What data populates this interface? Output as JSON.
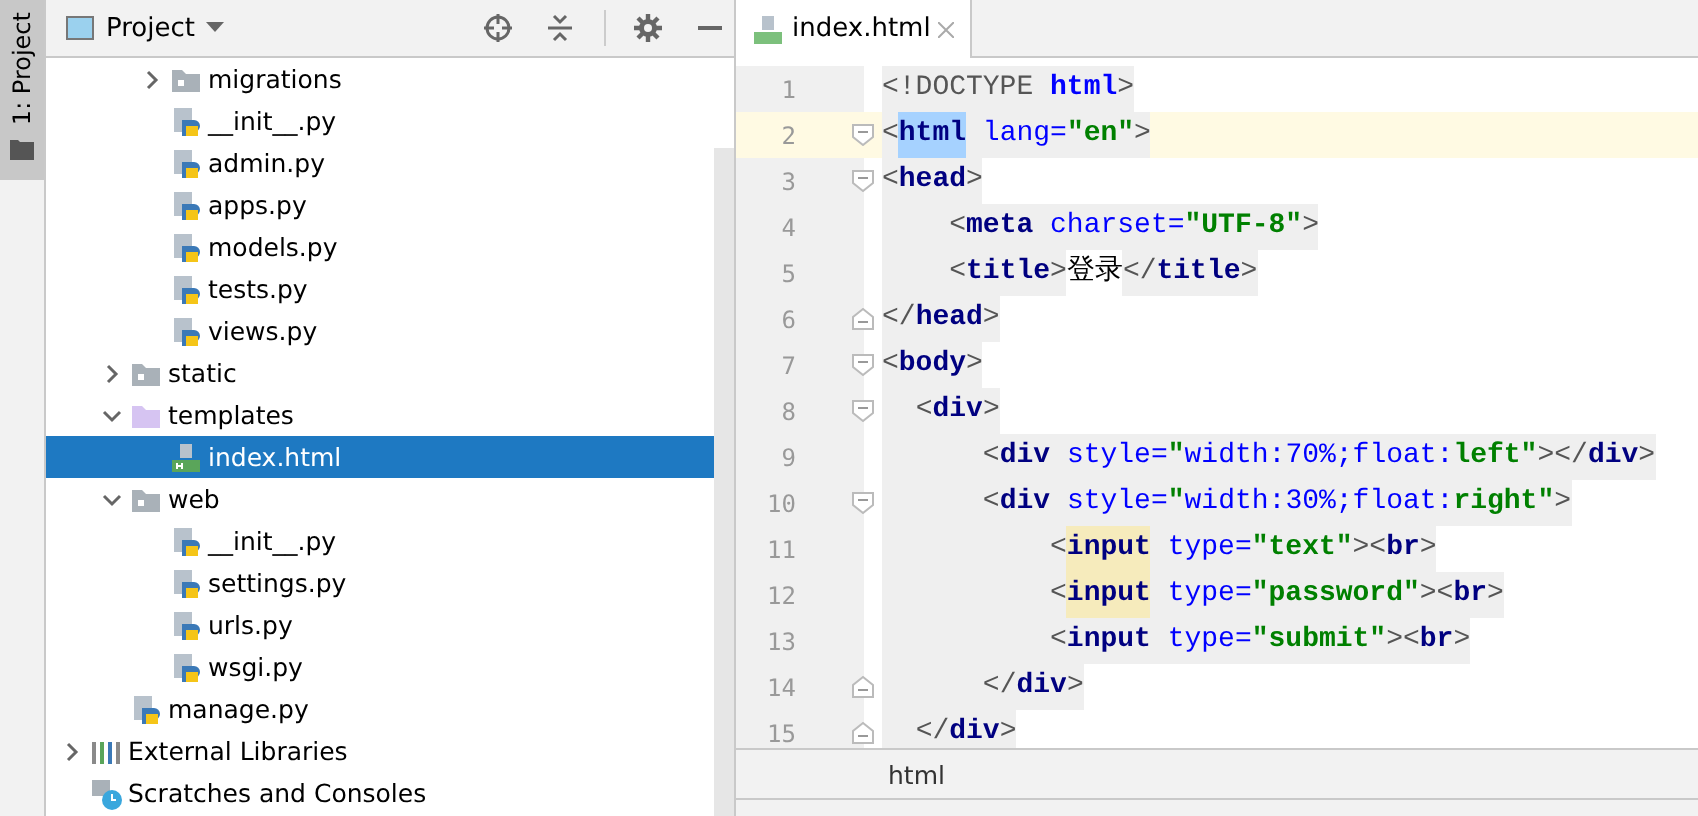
{
  "side_strip": {
    "label": "1: Project"
  },
  "project_panel": {
    "title": "Project",
    "tree": [
      {
        "kind": "hidden",
        "children": [
          {
            "kind": "hidden",
            "children": [
              {
                "label": "migrations",
                "kind": "folder",
                "expanded": false,
                "selected": false
              },
              {
                "label": "__init__.py",
                "kind": "python",
                "selected": false
              },
              {
                "label": "admin.py",
                "kind": "python",
                "selected": false
              },
              {
                "label": "apps.py",
                "kind": "python",
                "selected": false
              },
              {
                "label": "models.py",
                "kind": "python",
                "selected": false
              },
              {
                "label": "tests.py",
                "kind": "python",
                "selected": false
              },
              {
                "label": "views.py",
                "kind": "python",
                "selected": false
              }
            ]
          },
          {
            "label": "static",
            "kind": "folder",
            "expanded": false,
            "selected": false
          },
          {
            "label": "templates",
            "kind": "template-folder",
            "expanded": true,
            "selected": false,
            "children": [
              {
                "label": "index.html",
                "kind": "html",
                "selected": true
              }
            ]
          },
          {
            "label": "web",
            "kind": "folder",
            "expanded": true,
            "selected": false,
            "children": [
              {
                "label": "__init__.py",
                "kind": "python",
                "selected": false
              },
              {
                "label": "settings.py",
                "kind": "python",
                "selected": false
              },
              {
                "label": "urls.py",
                "kind": "python",
                "selected": false
              },
              {
                "label": "wsgi.py",
                "kind": "python",
                "selected": false
              }
            ]
          },
          {
            "label": "manage.py",
            "kind": "python",
            "selected": false
          }
        ]
      },
      {
        "label": "External Libraries",
        "kind": "library",
        "expanded": false,
        "selected": false
      },
      {
        "label": "Scratches and Consoles",
        "kind": "scratches",
        "selected": false
      }
    ]
  },
  "editor": {
    "tabs": [
      {
        "label": "index.html",
        "selected": true
      }
    ],
    "lines": [
      {
        "number": "1",
        "current": false,
        "fold_start": false,
        "fold_end": false,
        "tokens": [
          {
            "kind": "punct",
            "text": "<!DOCTYPE "
          },
          {
            "kind": "keyword",
            "text": "html"
          },
          {
            "kind": "punct",
            "text": ">"
          }
        ]
      },
      {
        "number": "2",
        "current": true,
        "fold_start": true,
        "fold_end": false,
        "tokens": [
          {
            "kind": "punct",
            "text": "<"
          },
          {
            "kind": "tag-match",
            "text": "html"
          },
          {
            "kind": "attr",
            "text": " lang="
          },
          {
            "kind": "value",
            "text": "\"en\""
          },
          {
            "kind": "punct",
            "text": ">"
          }
        ]
      },
      {
        "number": "3",
        "current": false,
        "fold_start": true,
        "fold_end": false,
        "tokens": [
          {
            "kind": "punct",
            "text": "<"
          },
          {
            "kind": "tag",
            "text": "head"
          },
          {
            "kind": "punct",
            "text": ">"
          }
        ]
      },
      {
        "number": "4",
        "current": false,
        "fold_start": false,
        "fold_end": false,
        "tokens": [
          {
            "kind": "punct",
            "text": "    <"
          },
          {
            "kind": "tag",
            "text": "meta"
          },
          {
            "kind": "attr",
            "text": " charset="
          },
          {
            "kind": "value",
            "text": "\"UTF-8\""
          },
          {
            "kind": "punct",
            "text": ">"
          }
        ]
      },
      {
        "number": "5",
        "current": false,
        "fold_start": false,
        "fold_end": false,
        "tokens": [
          {
            "kind": "punct",
            "text": "    <"
          },
          {
            "kind": "tag",
            "text": "title"
          },
          {
            "kind": "punct",
            "text": ">"
          },
          {
            "kind": "text",
            "text": "登录"
          },
          {
            "kind": "punct",
            "text": "</"
          },
          {
            "kind": "tag",
            "text": "title"
          },
          {
            "kind": "punct",
            "text": ">"
          }
        ]
      },
      {
        "number": "6",
        "current": false,
        "fold_start": false,
        "fold_end": true,
        "tokens": [
          {
            "kind": "punct",
            "text": "</"
          },
          {
            "kind": "tag",
            "text": "head"
          },
          {
            "kind": "punct",
            "text": ">"
          }
        ]
      },
      {
        "number": "7",
        "current": false,
        "fold_start": true,
        "fold_end": false,
        "tokens": [
          {
            "kind": "punct",
            "text": "<"
          },
          {
            "kind": "tag",
            "text": "body"
          },
          {
            "kind": "punct",
            "text": ">"
          }
        ]
      },
      {
        "number": "8",
        "current": false,
        "fold_start": true,
        "fold_end": false,
        "tokens": [
          {
            "kind": "punct",
            "text": "  <"
          },
          {
            "kind": "tag",
            "text": "div"
          },
          {
            "kind": "punct",
            "text": ">"
          }
        ]
      },
      {
        "number": "9",
        "current": false,
        "fold_start": false,
        "fold_end": false,
        "tokens": [
          {
            "kind": "punct",
            "text": "      <"
          },
          {
            "kind": "tag",
            "text": "div"
          },
          {
            "kind": "attr",
            "text": " style="
          },
          {
            "kind": "value",
            "text": "\""
          },
          {
            "kind": "css",
            "text": "width:70%;float:"
          },
          {
            "kind": "value",
            "text": "left\""
          },
          {
            "kind": "punct",
            "text": "></"
          },
          {
            "kind": "tag",
            "text": "div"
          },
          {
            "kind": "punct",
            "text": ">"
          }
        ]
      },
      {
        "number": "10",
        "current": false,
        "fold_start": true,
        "fold_end": false,
        "tokens": [
          {
            "kind": "punct",
            "text": "      <"
          },
          {
            "kind": "tag",
            "text": "div"
          },
          {
            "kind": "attr",
            "text": " style="
          },
          {
            "kind": "value",
            "text": "\""
          },
          {
            "kind": "css",
            "text": "width:30%;float:"
          },
          {
            "kind": "value",
            "text": "right\""
          },
          {
            "kind": "punct",
            "text": ">"
          }
        ]
      },
      {
        "number": "11",
        "current": false,
        "fold_start": false,
        "fold_end": false,
        "tokens": [
          {
            "kind": "punct",
            "text": "          <"
          },
          {
            "kind": "tag-usage",
            "text": "input"
          },
          {
            "kind": "attr",
            "text": " type="
          },
          {
            "kind": "value",
            "text": "\"text\""
          },
          {
            "kind": "punct",
            "text": "><"
          },
          {
            "kind": "tag",
            "text": "br"
          },
          {
            "kind": "punct",
            "text": ">"
          }
        ]
      },
      {
        "number": "12",
        "current": false,
        "fold_start": false,
        "fold_end": false,
        "tokens": [
          {
            "kind": "punct",
            "text": "          <"
          },
          {
            "kind": "tag-usage",
            "text": "input"
          },
          {
            "kind": "attr",
            "text": " type="
          },
          {
            "kind": "value",
            "text": "\"password\""
          },
          {
            "kind": "punct",
            "text": "><"
          },
          {
            "kind": "tag",
            "text": "br"
          },
          {
            "kind": "punct",
            "text": ">"
          }
        ]
      },
      {
        "number": "13",
        "current": false,
        "fold_start": false,
        "fold_end": false,
        "tokens": [
          {
            "kind": "punct",
            "text": "          <"
          },
          {
            "kind": "tag",
            "text": "input"
          },
          {
            "kind": "attr",
            "text": " type="
          },
          {
            "kind": "value",
            "text": "\"submit\""
          },
          {
            "kind": "punct",
            "text": "><"
          },
          {
            "kind": "tag",
            "text": "br"
          },
          {
            "kind": "punct",
            "text": ">"
          }
        ]
      },
      {
        "number": "14",
        "current": false,
        "fold_start": false,
        "fold_end": true,
        "tokens": [
          {
            "kind": "punct",
            "text": "      </"
          },
          {
            "kind": "tag",
            "text": "div"
          },
          {
            "kind": "punct",
            "text": ">"
          }
        ]
      },
      {
        "number": "15",
        "current": false,
        "fold_start": false,
        "fold_end": true,
        "tokens": [
          {
            "kind": "punct",
            "text": "  </"
          },
          {
            "kind": "tag",
            "text": "div"
          },
          {
            "kind": "punct",
            "text": ">"
          }
        ]
      }
    ],
    "breadcrumb": "html"
  }
}
